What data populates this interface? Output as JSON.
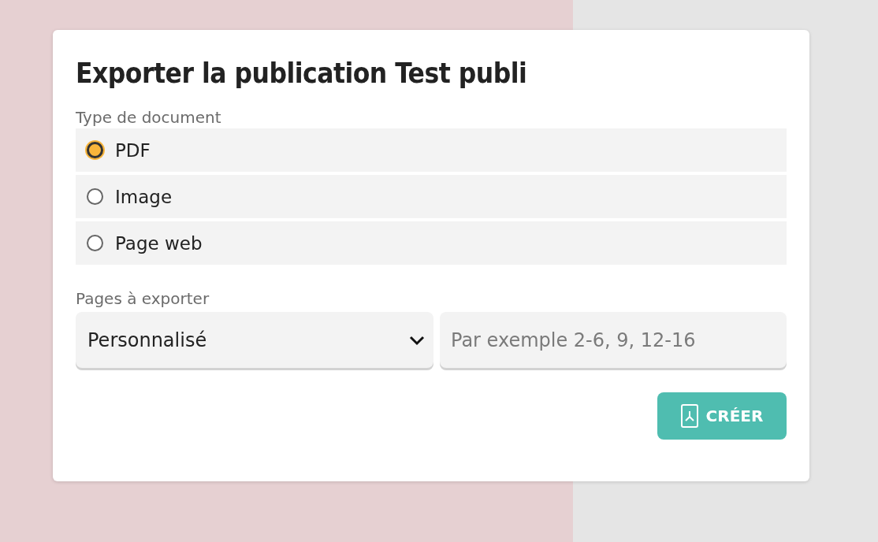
{
  "dialog": {
    "title": "Exporter la publication Test publi",
    "document_type": {
      "label": "Type de document",
      "options": [
        {
          "label": "PDF",
          "selected": true
        },
        {
          "label": "Image",
          "selected": false
        },
        {
          "label": "Page web",
          "selected": false
        }
      ]
    },
    "pages": {
      "label": "Pages à exporter",
      "select_value": "Personnalisé",
      "range_placeholder": "Par exemple 2-6, 9, 12-16"
    },
    "button": "CRÉER"
  }
}
